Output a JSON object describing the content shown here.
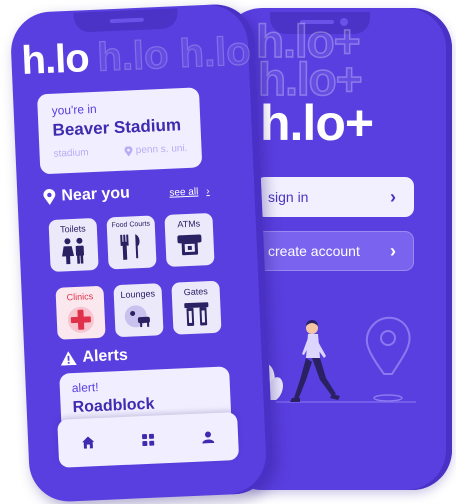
{
  "brand": {
    "logo": "h.lo",
    "logo_plus": "h.lo+",
    "ghost_row1": "h.lo h.lo h.l",
    "ghost_back_row1": "h.lo+",
    "ghost_back_row2": "h.lo+"
  },
  "auth": {
    "sign_in_label": "sign in",
    "create_account_label": "create account"
  },
  "location": {
    "prefix": "you're in",
    "venue": "Beaver Stadium",
    "area": "stadium",
    "city": "penn s. uni."
  },
  "near_you": {
    "title": "Near you",
    "see_all": "see all",
    "tiles": [
      {
        "label": "Toilets",
        "icon": "restroom-icon"
      },
      {
        "label": "Food Courts",
        "icon": "food-icon"
      },
      {
        "label": "ATMs",
        "icon": "atm-icon"
      },
      {
        "label": "Clinics",
        "icon": "medical-cross-icon"
      },
      {
        "label": "Lounges",
        "icon": "lounge-icon"
      },
      {
        "label": "Gates",
        "icon": "gate-icon"
      }
    ]
  },
  "alerts": {
    "title": "Alerts",
    "card_label": "alert!",
    "card_title": "Roadblock"
  },
  "nav": [
    "home-icon",
    "grid-icon",
    "profile-icon"
  ],
  "colors": {
    "primary": "#5a3fe0",
    "card": "#f1efff",
    "accent_red": "#e0304a"
  }
}
